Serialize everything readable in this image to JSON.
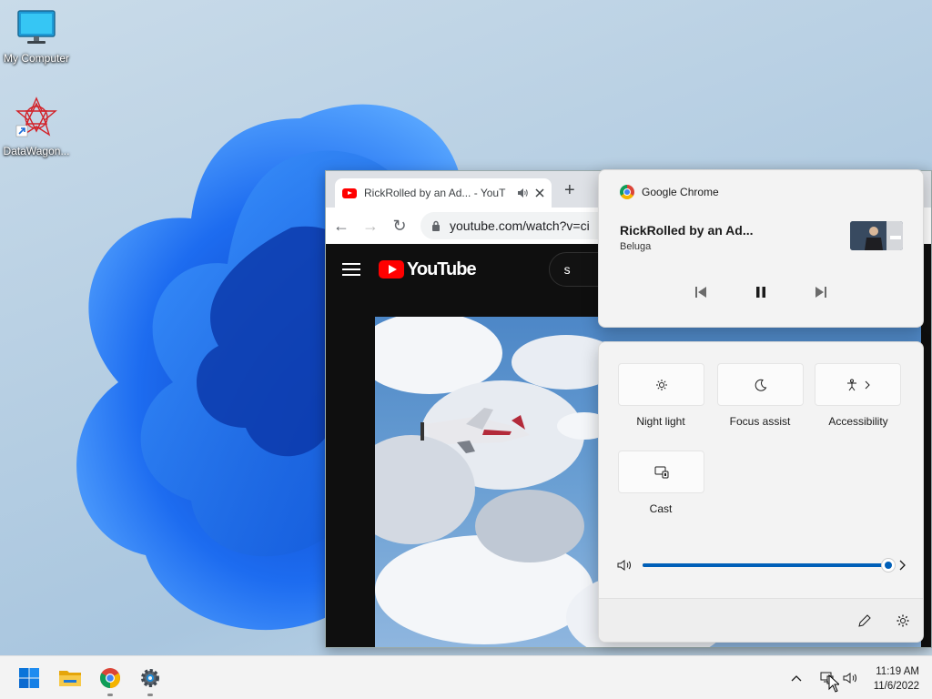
{
  "desktop": {
    "icons": [
      {
        "label": "My Computer"
      },
      {
        "label": "DataWagon..."
      }
    ]
  },
  "browser": {
    "tab_title": "RickRolled by an Ad... - YouT",
    "address": "youtube.com/watch?v=ci",
    "youtube_logo_text": "YouTube",
    "search_text": "s"
  },
  "media_flyout": {
    "app_name": "Google Chrome",
    "track_title": "RickRolled by an Ad...",
    "artist": "Beluga",
    "controls": [
      "previous-track",
      "pause",
      "next-track"
    ]
  },
  "quick_settings": {
    "tiles": [
      {
        "label": "Night light",
        "icon": "brightness-icon"
      },
      {
        "label": "Focus assist",
        "icon": "moon-icon"
      },
      {
        "label": "Accessibility",
        "icon": "accessibility-icon"
      },
      {
        "label": "Cast",
        "icon": "cast-icon"
      }
    ],
    "volume_level": 1.0,
    "accent_color": "#005fb8"
  },
  "taskbar": {
    "apps": [
      "start",
      "file-explorer",
      "chrome",
      "settings"
    ],
    "time": "11:19 AM",
    "date": "11/6/2022"
  }
}
